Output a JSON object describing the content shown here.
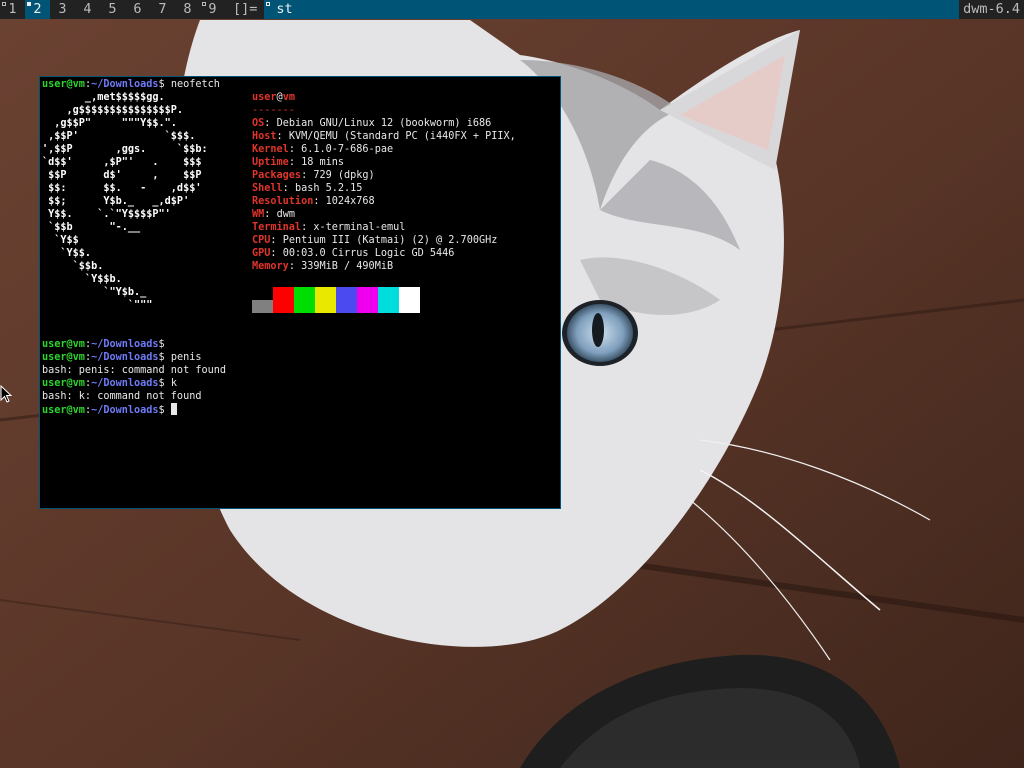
{
  "bar": {
    "tags": [
      {
        "label": "1",
        "selected": false,
        "occupied": true
      },
      {
        "label": "2",
        "selected": true,
        "occupied": true
      },
      {
        "label": "3",
        "selected": false,
        "occupied": false
      },
      {
        "label": "4",
        "selected": false,
        "occupied": false
      },
      {
        "label": "5",
        "selected": false,
        "occupied": false
      },
      {
        "label": "6",
        "selected": false,
        "occupied": false
      },
      {
        "label": "7",
        "selected": false,
        "occupied": false
      },
      {
        "label": "8",
        "selected": false,
        "occupied": false
      },
      {
        "label": "9",
        "selected": false,
        "occupied": true
      }
    ],
    "layout_symbol": "[]=",
    "window_title": "st",
    "status": "dwm-6.4",
    "colors": {
      "selected_bg": "#005577",
      "normal_bg": "#222222",
      "normal_fg": "#bbbbbb",
      "selected_fg": "#eeeeee"
    }
  },
  "terminal": {
    "prompt": {
      "user_host": "user@vm",
      "separator": ":",
      "path": "~/Downloads",
      "symbol": "$"
    },
    "first_command": "neofetch",
    "ascii_art": [
      "       _,met$$$$$gg.",
      "    ,g$$$$$$$$$$$$$$$P.",
      "  ,g$$P\"     \"\"\"Y$$.\".",
      " ,$$P'              `$$$.",
      "',$$P       ,ggs.     `$$b:",
      "`d$$'     ,$P\"'   .    $$$",
      " $$P      d$'     ,    $$P",
      " $$:      $$.   -    ,d$$'",
      " $$;      Y$b._   _,d$P'",
      " Y$$.    `.`\"Y$$$$P\"'",
      " `$$b      \"-.__",
      "  `Y$$",
      "   `Y$$.",
      "     `$$b.",
      "       `Y$$b.",
      "          `\"Y$b._",
      "              `\"\"\""
    ],
    "neofetch": {
      "user": "user",
      "at": "@",
      "host": "vm",
      "separator": "-------",
      "fields": [
        {
          "key": "OS",
          "value": "Debian GNU/Linux 12 (bookworm) i686"
        },
        {
          "key": "Host",
          "value": "KVM/QEMU (Standard PC (i440FX + PIIX,"
        },
        {
          "key": "Kernel",
          "value": "6.1.0-7-686-pae"
        },
        {
          "key": "Uptime",
          "value": "18 mins"
        },
        {
          "key": "Packages",
          "value": "729 (dpkg)"
        },
        {
          "key": "Shell",
          "value": "bash 5.2.15"
        },
        {
          "key": "Resolution",
          "value": "1024x768"
        },
        {
          "key": "WM",
          "value": "dwm"
        },
        {
          "key": "Terminal",
          "value": "x-terminal-emul"
        },
        {
          "key": "CPU",
          "value": "Pentium III (Katmai) (2) @ 2.700GHz"
        },
        {
          "key": "GPU",
          "value": "00:03.0 Cirrus Logic GD 5446"
        },
        {
          "key": "Memory",
          "value": "339MiB / 490MiB"
        }
      ],
      "palette": [
        "#808080",
        "#ff0000",
        "#00dd00",
        "#e8e800",
        "#4a4af0",
        "#ee00ee",
        "#00dddd",
        "#ffffff"
      ]
    },
    "history": [
      {
        "type": "prompt",
        "command": ""
      },
      {
        "type": "prompt",
        "command": "penis"
      },
      {
        "type": "output",
        "text": "bash: penis: command not found"
      },
      {
        "type": "prompt",
        "command": "k"
      },
      {
        "type": "output",
        "text": "bash: k: command not found"
      },
      {
        "type": "prompt",
        "command": "",
        "cursor": true
      }
    ]
  }
}
